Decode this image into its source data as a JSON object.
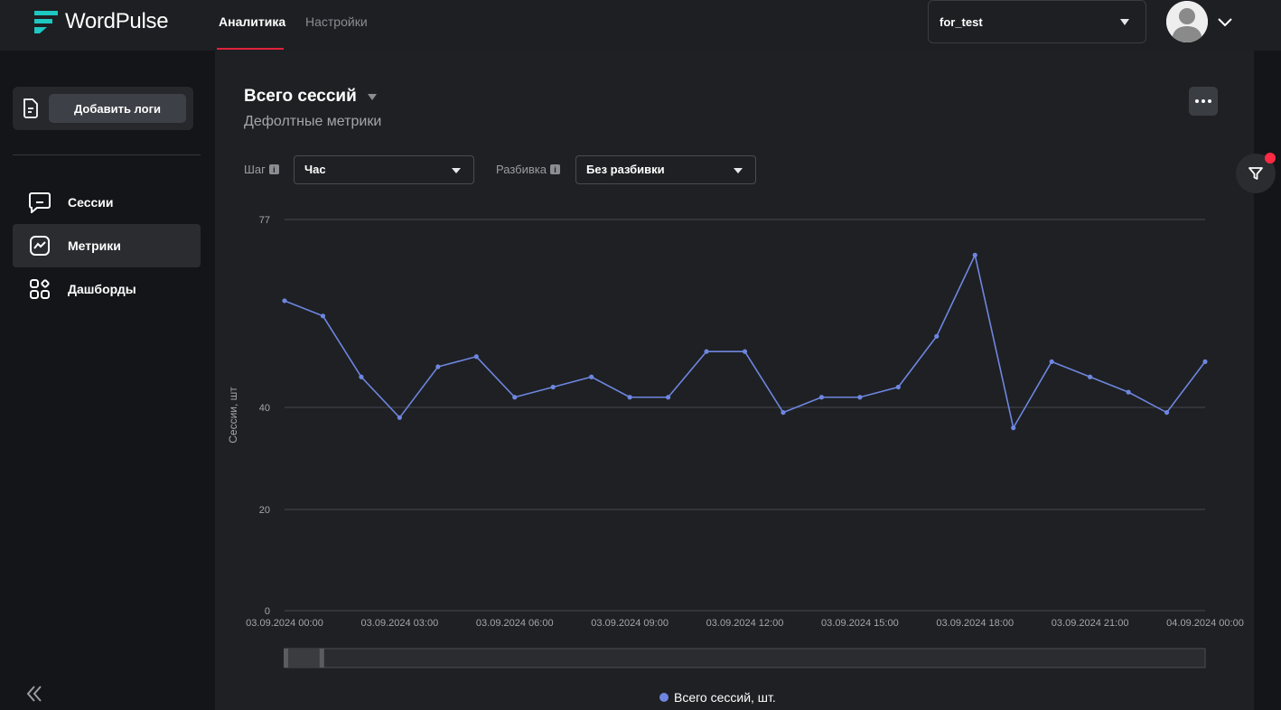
{
  "app": {
    "brand": "WordPulse",
    "brand_color": "#1fc7c2",
    "accent_color": "#e0223a"
  },
  "header": {
    "tabs": [
      {
        "label": "Аналитика",
        "active": true
      },
      {
        "label": "Настройки",
        "active": false
      }
    ],
    "project": {
      "value": "for_test"
    },
    "avatar_icon": "user-avatar-icon",
    "menu_icon": "chevron-down-icon"
  },
  "sidebar": {
    "add_logs_icon": "document-icon",
    "add_logs_label": "Добавить логи",
    "items": [
      {
        "label": "Сессии",
        "icon": "chat-bubble-icon",
        "active": false
      },
      {
        "label": "Метрики",
        "icon": "line-chart-icon",
        "active": true
      },
      {
        "label": "Дашборды",
        "icon": "dashboard-grid-icon",
        "active": false
      }
    ],
    "collapse_icon": "double-chevron-left-icon"
  },
  "main": {
    "title": "Всего сессий",
    "subtitle": "Дефолтные метрики",
    "more_icon": "more-horizontal-icon",
    "filter_icon": "filter-icon",
    "step": {
      "label": "Шаг",
      "value": "Час",
      "info_icon": "info-icon"
    },
    "breakdown": {
      "label": "Разбивка",
      "value": "Без разбивки",
      "info_icon": "info-icon"
    }
  },
  "chart_data": {
    "type": "line",
    "ylabel": "Сессии, шт",
    "yticks": [
      0,
      20,
      40,
      77
    ],
    "ylim": [
      0,
      77
    ],
    "xlim": [
      "03.09.2024 00:00",
      "04.09.2024 00:00"
    ],
    "xticks": [
      "03.09.2024 00:00",
      "03.09.2024 03:00",
      "03.09.2024 06:00",
      "03.09.2024 09:00",
      "03.09.2024 12:00",
      "03.09.2024 15:00",
      "03.09.2024 18:00",
      "03.09.2024 21:00",
      "04.09.2024 00:00"
    ],
    "grid": true,
    "series": [
      {
        "name": "Всего сессий, шт.",
        "color": "#6e86e0",
        "x": [
          "03.09.2024 00:00",
          "03.09.2024 01:00",
          "03.09.2024 02:00",
          "03.09.2024 03:00",
          "03.09.2024 04:00",
          "03.09.2024 05:00",
          "03.09.2024 06:00",
          "03.09.2024 07:00",
          "03.09.2024 08:00",
          "03.09.2024 09:00",
          "03.09.2024 10:00",
          "03.09.2024 11:00",
          "03.09.2024 12:00",
          "03.09.2024 13:00",
          "03.09.2024 14:00",
          "03.09.2024 15:00",
          "03.09.2024 16:00",
          "03.09.2024 17:00",
          "03.09.2024 18:00",
          "03.09.2024 19:00",
          "03.09.2024 20:00",
          "03.09.2024 21:00",
          "03.09.2024 22:00",
          "03.09.2024 23:00",
          "04.09.2024 00:00"
        ],
        "values": [
          61,
          58,
          46,
          38,
          48,
          50,
          42,
          44,
          46,
          42,
          42,
          51,
          51,
          39,
          42,
          42,
          44,
          54,
          70,
          36,
          49,
          46,
          43,
          39,
          49
        ]
      }
    ],
    "legend": {
      "position": "bottom-center",
      "label": "Всего сессий, шт."
    },
    "zoom_slider": {
      "start": 0,
      "end": 0.04
    }
  }
}
